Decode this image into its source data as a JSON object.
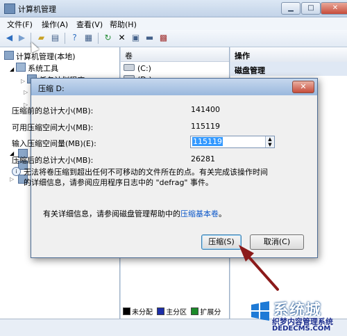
{
  "window": {
    "title": "计算机管理",
    "controls": [
      "▁",
      "□",
      "✕"
    ]
  },
  "menu": [
    "文件(F)",
    "操作(A)",
    "查看(V)",
    "帮助(H)"
  ],
  "tree": {
    "root": "计算机管理(本地)",
    "system_tools": "系统工具",
    "partial_child": "任务计划程序"
  },
  "volumes": {
    "header": "卷",
    "items": [
      "(C:)",
      "(D:)"
    ]
  },
  "legend": [
    "未分配",
    "主分区",
    "扩展分"
  ],
  "actions": {
    "header": "操作",
    "sub": "磁盘管理"
  },
  "dialog": {
    "title": "压缩 D:",
    "close": "✕",
    "fields": [
      {
        "label": "压缩前的总计大小(MB):",
        "value": "141400"
      },
      {
        "label": "可用压缩空间大小(MB):",
        "value": "115119"
      },
      {
        "label": "输入压缩空间量(MB)(E):",
        "value": "115119"
      },
      {
        "label": "压缩后的总计大小(MB):",
        "value": "26281"
      }
    ],
    "notice": "无法将卷压缩到超出任何不可移动的文件所在的点。有关完成该操作时间的详细信息，请参阅应用程序日志中的 \"defrag\" 事件。",
    "help_prefix": "有关详细信息，请参阅磁盘管理帮助中的",
    "help_link": "压缩基本卷",
    "help_suffix": "。",
    "shrink_button": "压缩(S)",
    "cancel_button": "取消(C)"
  },
  "watermark": {
    "big": "系统城",
    "small": "织梦内容管理系统",
    "url": "DEDECMS.COM"
  },
  "colors": {
    "accent": "#3399ff",
    "arrow": "#8b1a1a",
    "link": "#0a56c8"
  }
}
